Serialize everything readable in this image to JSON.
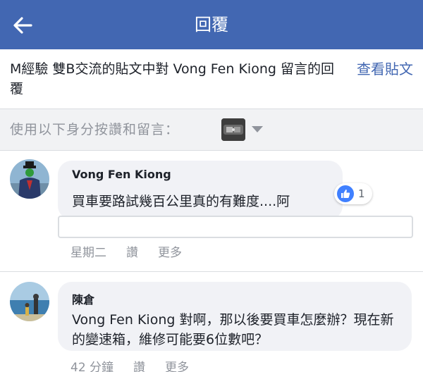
{
  "header": {
    "title": "回覆"
  },
  "context": {
    "text": "M經驗 雙B交流的貼文中對 Vong Fen Kiong 留言的回覆",
    "view_post_label": "查看貼文"
  },
  "identity": {
    "label": "使用以下身分按讚和留言："
  },
  "comments": [
    {
      "author": "Vong Fen Kiong",
      "text": "買車要路試幾百公里真的有難度....阿",
      "like_count": "1",
      "time": "星期二",
      "like_action": "讚",
      "more_action": "更多"
    },
    {
      "author": "陳倉",
      "text": "Vong Fen Kiong 對啊，那以後要買車怎麼辦？現在新的變速箱，維修可能要6位數吧？",
      "time": "42 分鐘",
      "like_action": "讚",
      "more_action": "更多"
    }
  ],
  "colors": {
    "brand": "#4267b2",
    "like": "#4080ff",
    "bubble": "#f1f2f6",
    "muted": "#90949c"
  }
}
